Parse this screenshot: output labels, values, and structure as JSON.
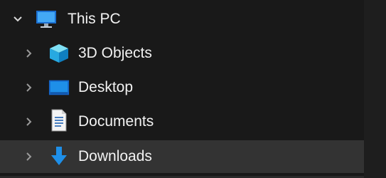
{
  "tree": {
    "root": {
      "label": "This PC",
      "expanded": true,
      "icon": "this-pc-icon"
    },
    "items": [
      {
        "label": "3D Objects",
        "icon": "3d-objects-icon",
        "expanded": false,
        "selected": false
      },
      {
        "label": "Desktop",
        "icon": "desktop-icon",
        "expanded": false,
        "selected": false
      },
      {
        "label": "Documents",
        "icon": "documents-icon",
        "expanded": false,
        "selected": false
      },
      {
        "label": "Downloads",
        "icon": "downloads-icon",
        "expanded": false,
        "selected": true
      }
    ]
  },
  "colors": {
    "background": "#191919",
    "text": "#f2f2f2",
    "selected_row": "#333333",
    "chevron": "#9a9a9a",
    "accent_blue": "#1e8fe8"
  }
}
